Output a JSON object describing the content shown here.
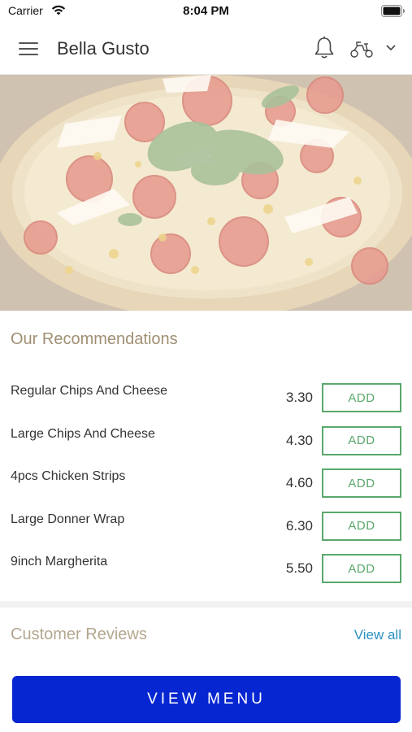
{
  "status_bar": {
    "carrier": "Carrier",
    "time": "8:04 PM"
  },
  "header": {
    "title": "Bella Gusto",
    "menu_icon": "hamburger-menu-icon",
    "notification_icon": "bell-icon",
    "delivery_icon": "scooter-icon",
    "dropdown_icon": "chevron-down-icon"
  },
  "hero": {
    "image": "pizza-photo"
  },
  "recommendations": {
    "title": "Our Recommendations",
    "items": [
      {
        "name": "Regular Chips And Cheese",
        "price": "3.30",
        "button": "ADD"
      },
      {
        "name": "Large Chips And Cheese",
        "price": "4.30",
        "button": "ADD"
      },
      {
        "name": "4pcs Chicken Strips",
        "price": "4.60",
        "button": "ADD"
      },
      {
        "name": "Large Donner Wrap",
        "price": "6.30",
        "button": "ADD"
      },
      {
        "name": "9inch Margherita",
        "price": "5.50",
        "button": "ADD"
      }
    ]
  },
  "reviews": {
    "title": "Customer Reviews",
    "view_all": "View all"
  },
  "footer": {
    "view_menu": "VIEW MENU"
  },
  "colors": {
    "accent_green": "#5aa86c",
    "section_title": "#a08f73",
    "link_blue": "#2b90c2",
    "primary_button": "#0526d0"
  }
}
